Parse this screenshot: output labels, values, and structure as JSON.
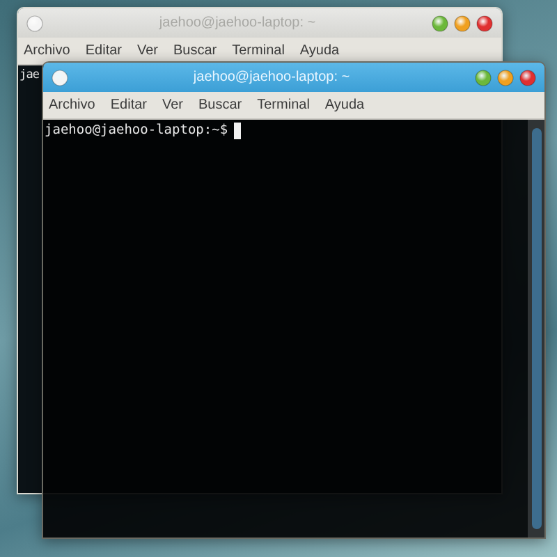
{
  "windows": [
    {
      "title": "jaehoo@jaehoo-laptop: ~",
      "active": false,
      "menu": [
        "Archivo",
        "Editar",
        "Ver",
        "Buscar",
        "Terminal",
        "Ayuda"
      ],
      "prompt": "jae"
    },
    {
      "title": "jaehoo@jaehoo-laptop: ~",
      "active": true,
      "menu": [
        "Archivo",
        "Editar",
        "Ver",
        "Buscar",
        "Terminal",
        "Ayuda"
      ],
      "prompt": "jaehoo@jaehoo-laptop:~$",
      "cursor": true
    }
  ]
}
